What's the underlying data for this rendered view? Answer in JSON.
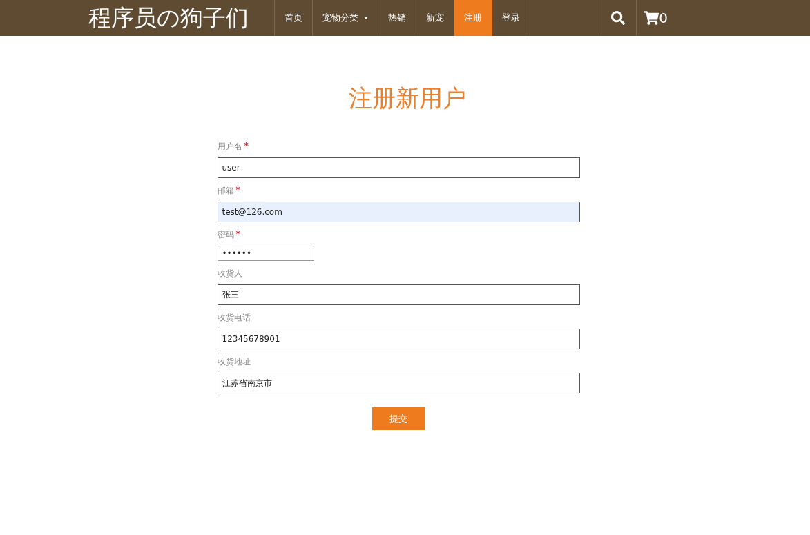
{
  "navbar": {
    "brand": "程序员の狗子们",
    "items": [
      {
        "label": "首页",
        "selected": false,
        "dropdown": false
      },
      {
        "label": "宠物分类",
        "selected": false,
        "dropdown": true
      },
      {
        "label": "热销",
        "selected": false,
        "dropdown": false
      },
      {
        "label": "新宠",
        "selected": false,
        "dropdown": false
      },
      {
        "label": "注册",
        "selected": true,
        "dropdown": false
      },
      {
        "label": "登录",
        "selected": false,
        "dropdown": false
      }
    ],
    "cart_count": "0"
  },
  "form": {
    "title": "注册新用户",
    "fields": [
      {
        "kind": "text",
        "label": "用户名",
        "required_mark": "*",
        "value": "user",
        "autofilled": false
      },
      {
        "kind": "text",
        "label": "邮箱",
        "required_mark": "*",
        "value": "test@126.com",
        "autofilled": true
      },
      {
        "kind": "password",
        "label": "密码",
        "required_mark": "*",
        "value": "••••••",
        "autofilled": false
      },
      {
        "kind": "text",
        "label": "收货人",
        "value": "张三",
        "autofilled": false
      },
      {
        "kind": "text",
        "label": "收货电话",
        "value": "12345678901",
        "autofilled": false
      },
      {
        "kind": "text",
        "label": "收货地址",
        "value": "江苏省南京市",
        "autofilled": false
      }
    ],
    "submit": "提交"
  }
}
